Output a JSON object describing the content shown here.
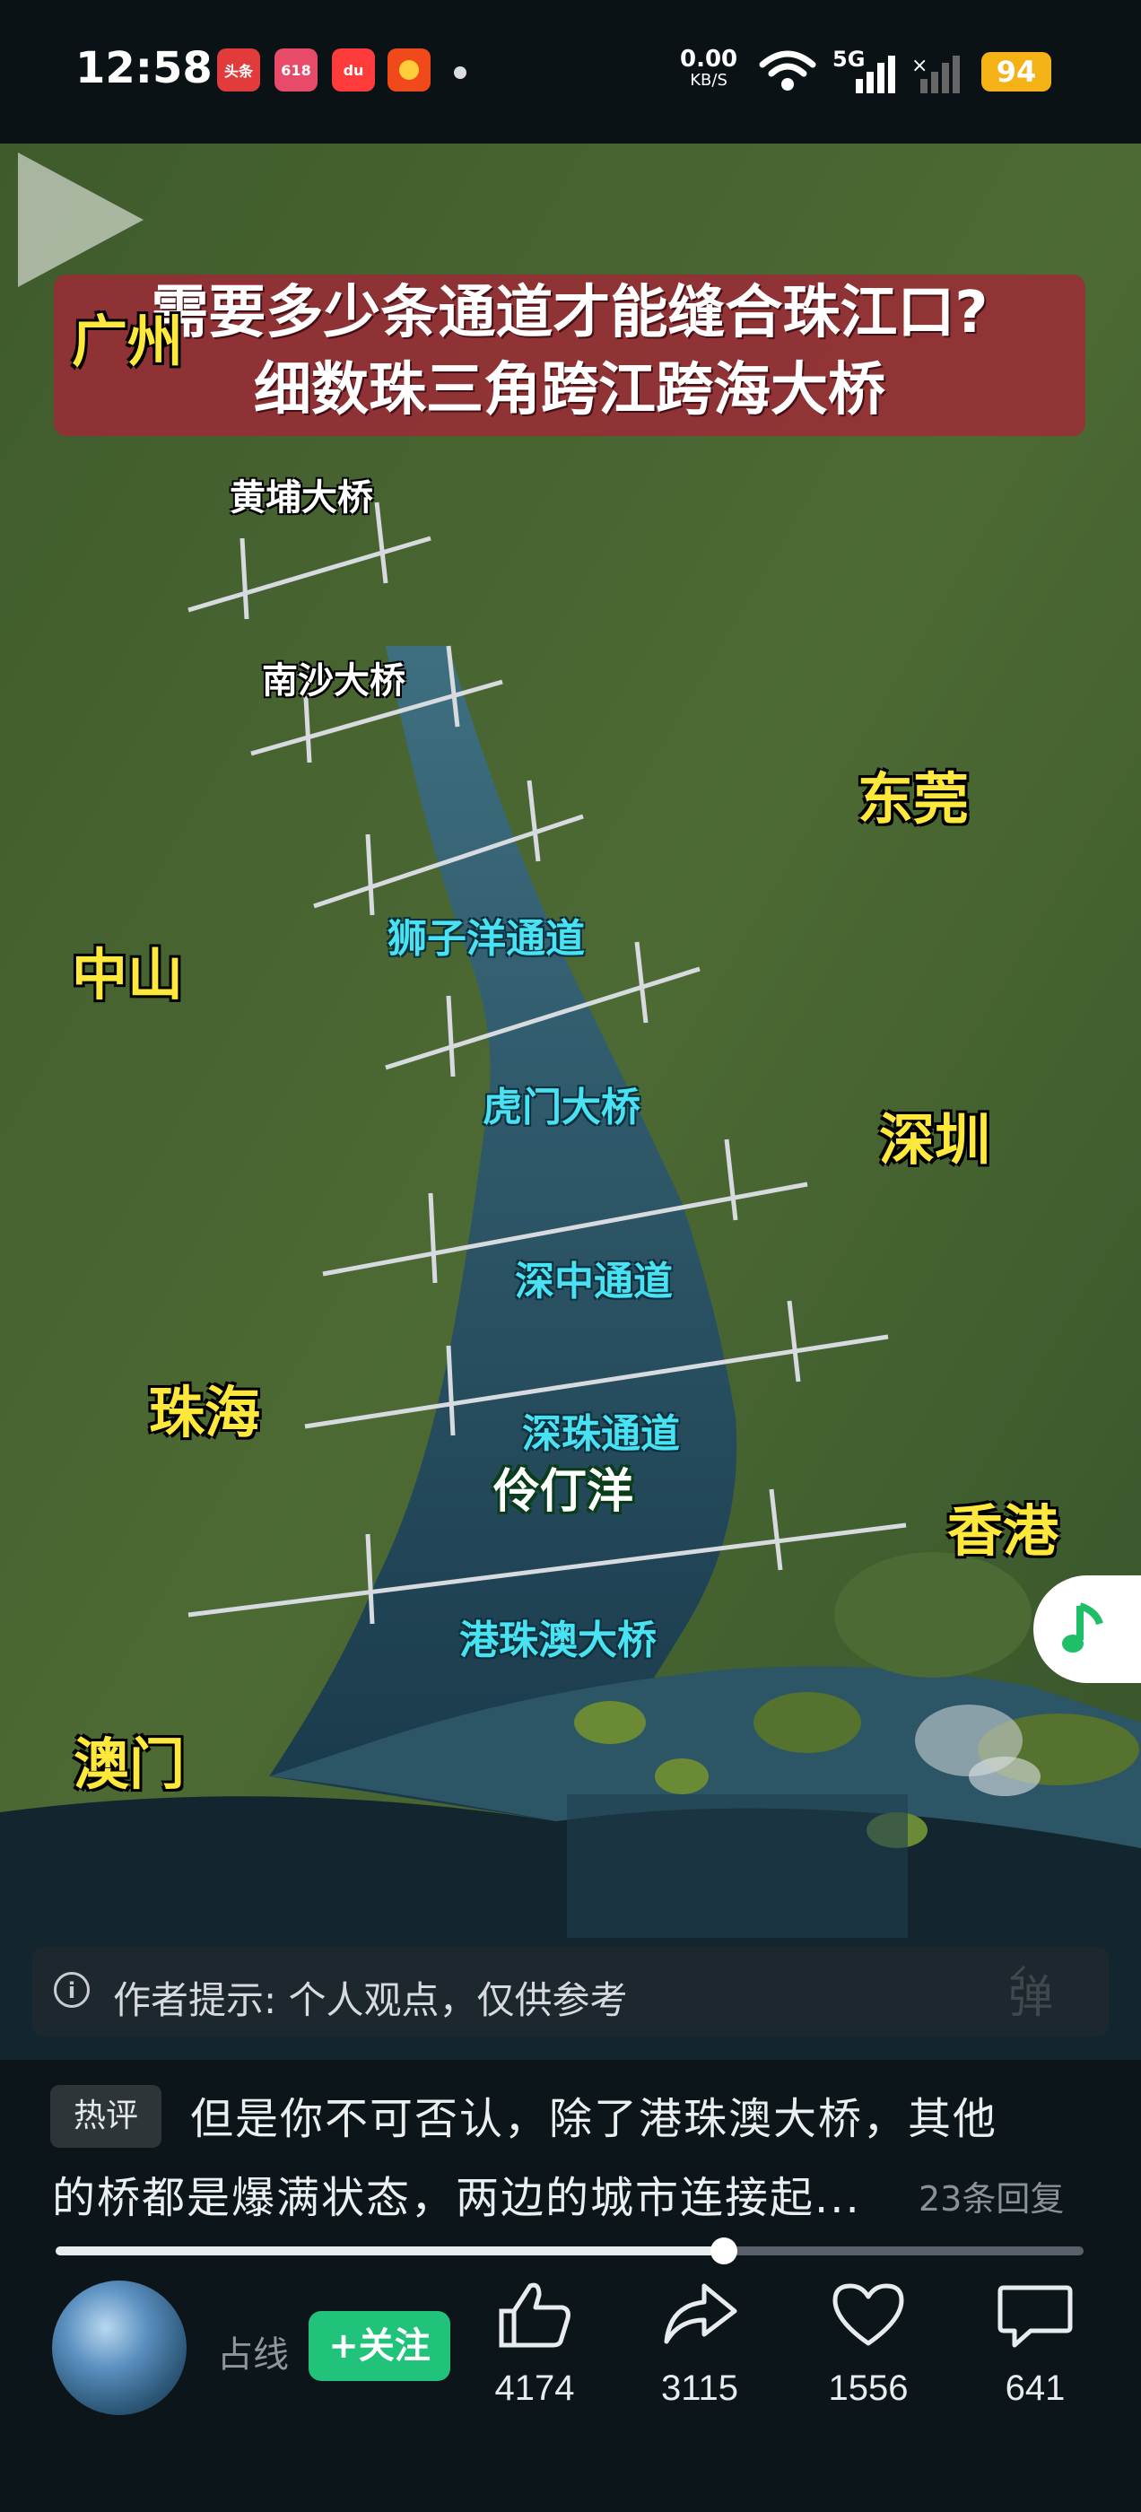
{
  "status_bar": {
    "time": "12:58",
    "app_icons": [
      {
        "name": "toutiao-app-icon",
        "label": "头条",
        "color": "#e23b3b"
      },
      {
        "name": "618-promo-app-icon",
        "label": "618",
        "color": "#e84a6a"
      },
      {
        "name": "du-app-icon",
        "label": "du",
        "color": "#ff3b3b"
      },
      {
        "name": "shopping-app-icon",
        "label": "",
        "color": "#f04a1a"
      }
    ],
    "net_speed": "0.00",
    "net_unit": "KB/S",
    "network": "5G",
    "battery": "94",
    "battery_color": "#f4b216"
  },
  "video": {
    "title_line1": "需要多少条通道才能缝合珠江口?",
    "title_line2": "细数珠三角跨江跨海大桥",
    "cities": {
      "guangzhou": "广州",
      "dongguan": "东莞",
      "zhongshan": "中山",
      "shenzhen": "深圳",
      "zhuhai": "珠海",
      "hongkong": "香港",
      "macau": "澳门"
    },
    "bridges": {
      "huangpu": "黄埔大桥",
      "nansha": "南沙大桥",
      "shiziyang": "狮子洋通道",
      "humen": "虎门大桥",
      "shenzhong": "深中通道",
      "shenzhu": "深珠通道",
      "gangzhuao": "港珠澳大桥"
    },
    "sea": "伶仃洋",
    "danmu_label": "弹"
  },
  "notice": {
    "icon": "info-icon",
    "text": "作者提示: 个人观点，仅供参考"
  },
  "comment": {
    "tag": "热评",
    "line1": "但是你不可否认，除了港珠澳大桥，其他",
    "line2": "的桥都是爆满状态，两边的城市连接起...",
    "replies": "23条回复"
  },
  "playback": {
    "progress": 0.65
  },
  "author": {
    "name": "占线",
    "follow_label": "+关注"
  },
  "actions": {
    "like": "4174",
    "share": "3115",
    "favorite": "1556",
    "comment": "641"
  }
}
